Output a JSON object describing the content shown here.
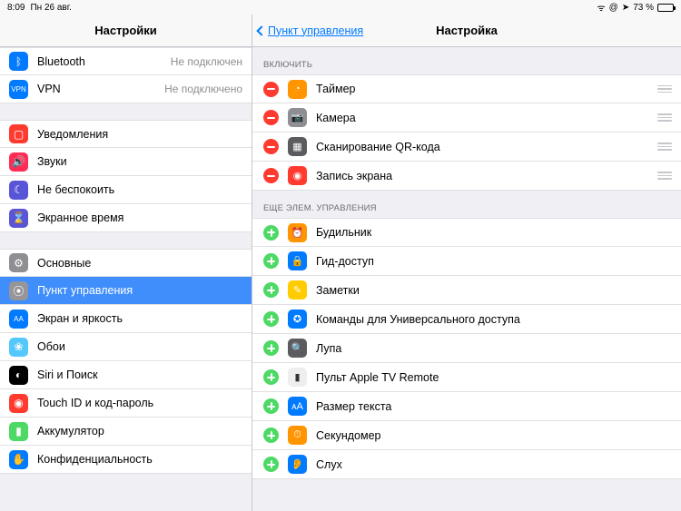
{
  "status": {
    "time": "8:09",
    "date": "Пн 26 авг.",
    "battery_pct": "73 %"
  },
  "sidebar": {
    "title": "Настройки",
    "group1": [
      {
        "label": "Bluetooth",
        "detail": "Не подключен",
        "icon": "bluetooth",
        "bg": "#007aff"
      },
      {
        "label": "VPN",
        "detail": "Не подключено",
        "icon": "vpn",
        "bg": "#007aff"
      }
    ],
    "group2": [
      {
        "label": "Уведомления",
        "icon": "bell",
        "bg": "#ff3b30"
      },
      {
        "label": "Звуки",
        "icon": "sound",
        "bg": "#ff2d55"
      },
      {
        "label": "Не беспокоить",
        "icon": "moon",
        "bg": "#5856d6"
      },
      {
        "label": "Экранное время",
        "icon": "hourglass",
        "bg": "#5856d6"
      }
    ],
    "group3": [
      {
        "label": "Основные",
        "icon": "gear",
        "bg": "#8e8e93"
      },
      {
        "label": "Пункт управления",
        "icon": "switches",
        "bg": "#8e8e93",
        "selected": true
      },
      {
        "label": "Экран и яркость",
        "icon": "AA",
        "bg": "#007aff"
      },
      {
        "label": "Обои",
        "icon": "flower",
        "bg": "#54c7fc"
      },
      {
        "label": "Siri и Поиск",
        "icon": "siri",
        "bg": "#000000"
      },
      {
        "label": "Touch ID и код-пароль",
        "icon": "finger",
        "bg": "#ff3b30"
      },
      {
        "label": "Аккумулятор",
        "icon": "battery",
        "bg": "#4cd964"
      },
      {
        "label": "Конфиденциальность",
        "icon": "hand",
        "bg": "#007aff"
      }
    ]
  },
  "main": {
    "back_label": "Пункт управления",
    "title": "Настройка",
    "include_header": "Включить",
    "more_header": "Еще элем. управления",
    "include": [
      {
        "label": "Таймер",
        "bg": "#ff9500",
        "glyph": "◔"
      },
      {
        "label": "Камера",
        "bg": "#8e8e93",
        "glyph": "📷"
      },
      {
        "label": "Сканирование QR-кода",
        "bg": "#5b5b60",
        "glyph": "▦"
      },
      {
        "label": "Запись экрана",
        "bg": "#ff3b30",
        "glyph": "◉"
      }
    ],
    "more": [
      {
        "label": "Будильник",
        "bg": "#ff9500",
        "glyph": "⏰"
      },
      {
        "label": "Гид-доступ",
        "bg": "#007aff",
        "glyph": "🔒"
      },
      {
        "label": "Заметки",
        "bg": "#ffcc00",
        "glyph": "✎"
      },
      {
        "label": "Команды для Универсального доступа",
        "bg": "#007aff",
        "glyph": "✪"
      },
      {
        "label": "Лупа",
        "bg": "#5b5b60",
        "glyph": "🔍"
      },
      {
        "label": "Пульт Apple TV Remote",
        "bg": "#eeeeee",
        "glyph": "▮",
        "fg": "#333"
      },
      {
        "label": "Размер текста",
        "bg": "#007aff",
        "glyph": "ᴀA"
      },
      {
        "label": "Секундомер",
        "bg": "#ff9500",
        "glyph": "⏱"
      },
      {
        "label": "Слух",
        "bg": "#007aff",
        "glyph": "👂"
      }
    ]
  }
}
